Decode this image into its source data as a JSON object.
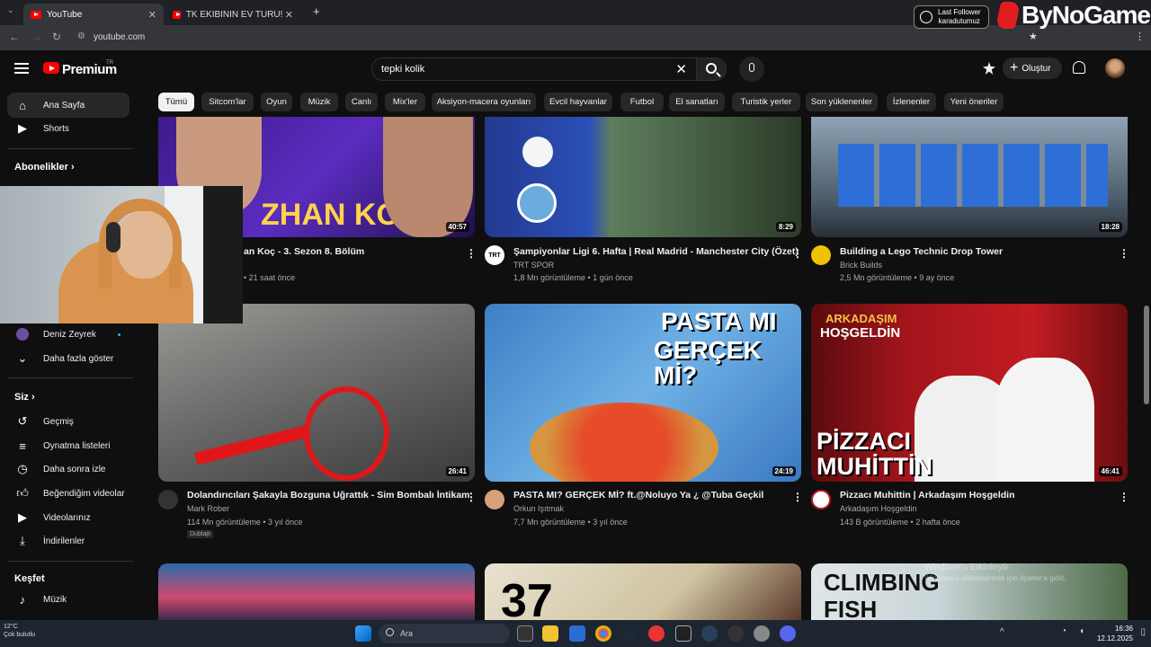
{
  "browser": {
    "tabs": [
      {
        "title": "YouTube",
        "active": true
      },
      {
        "title": "TK EKİBİNİN EV TURU! (ORHAN",
        "active": false
      }
    ],
    "url": "youtube.com"
  },
  "overlay": {
    "last_follower_line1": "Last Follower",
    "last_follower_line2": "karadutumuz",
    "brand": "ByNoGame"
  },
  "header": {
    "logo_text": "Premium",
    "country_code": "TR",
    "search_value": "tepki kolik",
    "create_label": "Oluştur"
  },
  "sidebar": {
    "top_items": [
      {
        "label": "Ana Sayfa",
        "icon": "home-icon"
      },
      {
        "label": "Shorts",
        "icon": "shorts-icon"
      }
    ],
    "subscriptions_heading": "Abonelikler",
    "subscription_channel": "Deniz Zeyrek",
    "show_more": "Daha fazla göster",
    "you_heading": "Siz",
    "you_items": [
      {
        "label": "Geçmiş",
        "icon": "history-icon"
      },
      {
        "label": "Oynatma listeleri",
        "icon": "playlist-icon"
      },
      {
        "label": "Daha sonra izle",
        "icon": "clock-icon"
      },
      {
        "label": "Beğendiğim videolar",
        "icon": "like-icon"
      },
      {
        "label": "Videolarınız",
        "icon": "video-icon"
      },
      {
        "label": "İndirilenler",
        "icon": "download-icon"
      }
    ],
    "explore_heading": "Keşfet",
    "explore_items": [
      {
        "label": "Müzik",
        "icon": "music-icon"
      }
    ]
  },
  "chips": [
    "Tümü",
    "Sitcom'lar",
    "Oyun",
    "Müzik",
    "Canlı",
    "Mix'ler",
    "Aksiyon-macera oyunları",
    "Evcil hayvanlar",
    "Futbol",
    "El sanatları",
    "Turistik yerler",
    "Son yüklenenler",
    "İzlenenler",
    "Yeni öneriler"
  ],
  "videos_row1": [
    {
      "title": "an Koç - 3. Sezon 8. Bölüm",
      "channel": "",
      "meta": "• 21 saat önce",
      "duration": "40:57",
      "thumb_text": "ZHAN KOÇ"
    },
    {
      "title": "Şampiyonlar Ligi 6. Hafta | Real Madrid - Manchester City (Özet)",
      "channel": "TRT SPOR",
      "meta": "1,8 Mn görüntüleme • 1 gün önce",
      "duration": "8:29"
    },
    {
      "title": "Building a Lego Technic Drop Tower",
      "channel": "Brick Builds",
      "meta": "2,5 Mn görüntüleme • 9 ay önce",
      "duration": "18:28"
    }
  ],
  "videos_row2": [
    {
      "title": "Dolandırıcıları Şakayla Bozguna Uğrattık - Sim Bombalı İntikam",
      "channel": "Mark Rober",
      "meta": "114 Mn görüntüleme • 3 yıl önce",
      "duration": "26:41",
      "badge": "Dublajlı"
    },
    {
      "title": "PASTA MI? GERÇEK Mİ? ft.@Noluyo Ya ¿ @Tuba Geçkil",
      "channel": "Orkun Işıtmak",
      "meta": "7,7 Mn görüntüleme • 3 yıl önce",
      "duration": "24:19",
      "thumb_text1": "PASTA MI",
      "thumb_text2": "GERÇEK Mİ?"
    },
    {
      "title": "Pizzacı Muhittin | Arkadaşım Hoşgeldin",
      "channel": "Arkadaşım Hoşgeldin",
      "meta": "143 B görüntüleme • 2 hafta önce",
      "duration": "46:41",
      "thumb_text1": "ARKADAŞIM",
      "thumb_text2": "HOŞGELDİN",
      "thumb_text3": "PİZZACI",
      "thumb_text4": "MUHİTTİN"
    }
  ],
  "videos_row3": [
    {
      "thumb_text": "37"
    },
    {
      "thumb_text1": "CLIMBING",
      "thumb_text2": "FISH"
    }
  ],
  "activation": {
    "line1": "Windows'u Etkinleştir",
    "line2": "Windows'u etkinleştirmek için Ayarlar'a gidin."
  },
  "taskbar": {
    "search_placeholder": "Ara",
    "time": "16:36",
    "date": "12.12.2025",
    "weather_temp": "12°C",
    "weather_desc": "Çok bulutlu"
  },
  "colors": {
    "accent": "#ff0000",
    "bg": "#0f0f0f",
    "chip": "#272727"
  }
}
